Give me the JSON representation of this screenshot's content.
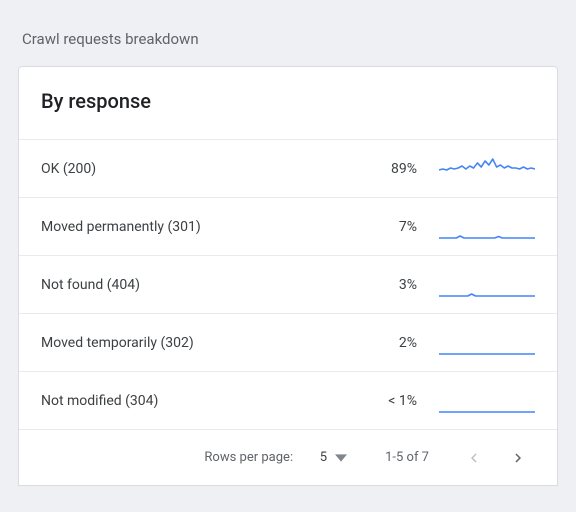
{
  "section_title": "Crawl requests breakdown",
  "card_title": "By response",
  "rows": [
    {
      "label": "OK (200)",
      "value": "89%"
    },
    {
      "label": "Moved permanently (301)",
      "value": "7%"
    },
    {
      "label": "Not found (404)",
      "value": "3%"
    },
    {
      "label": "Moved temporarily (302)",
      "value": "2%"
    },
    {
      "label": "Not modified (304)",
      "value": "< 1%"
    }
  ],
  "pager": {
    "rows_per_page_label": "Rows per page:",
    "page_size": "5",
    "range_text": "1-5 of 7"
  },
  "chart_data": {
    "type": "table",
    "title": "By response",
    "categories": [
      "OK (200)",
      "Moved permanently (301)",
      "Not found (404)",
      "Moved temporarily (302)",
      "Not modified (304)"
    ],
    "values_pct": [
      89,
      7,
      3,
      2,
      0.5
    ],
    "value_labels": [
      "89%",
      "7%",
      "3%",
      "2%",
      "< 1%"
    ],
    "sparklines_note": "Each row shows a trend sparkline of relative request volume over time; y-axis is unlabeled/normalized.",
    "series": [
      {
        "name": "OK (200)",
        "values": [
          10,
          11,
          11,
          10,
          12,
          11,
          13,
          11,
          13,
          12,
          15,
          13,
          17,
          14,
          18,
          13,
          14,
          12,
          13,
          12,
          12,
          11,
          12,
          11
        ]
      },
      {
        "name": "Moved permanently (301)",
        "values": [
          0,
          0,
          0,
          0,
          0,
          0,
          1,
          0,
          0,
          0,
          0,
          0,
          0,
          0,
          0,
          0,
          1,
          0,
          0,
          0,
          0,
          0,
          0,
          0
        ]
      },
      {
        "name": "Not found (404)",
        "values": [
          0,
          0,
          0,
          0,
          0,
          0,
          0,
          1,
          0,
          0,
          0,
          0,
          0,
          0,
          0,
          0,
          0,
          0,
          0,
          0,
          0,
          0,
          0,
          0
        ]
      },
      {
        "name": "Moved temporarily (302)",
        "values": [
          0,
          0,
          0,
          0,
          0,
          0,
          0,
          0,
          0,
          0,
          0,
          0,
          0,
          0,
          0,
          0,
          0,
          0,
          0,
          0,
          0,
          0,
          0,
          0
        ]
      },
      {
        "name": "Not modified (304)",
        "values": [
          0,
          0,
          0,
          0,
          0,
          0,
          0,
          0,
          0,
          0,
          0,
          0,
          0,
          0,
          0,
          0,
          0,
          0,
          0,
          0,
          0,
          0,
          0,
          0
        ]
      }
    ]
  }
}
